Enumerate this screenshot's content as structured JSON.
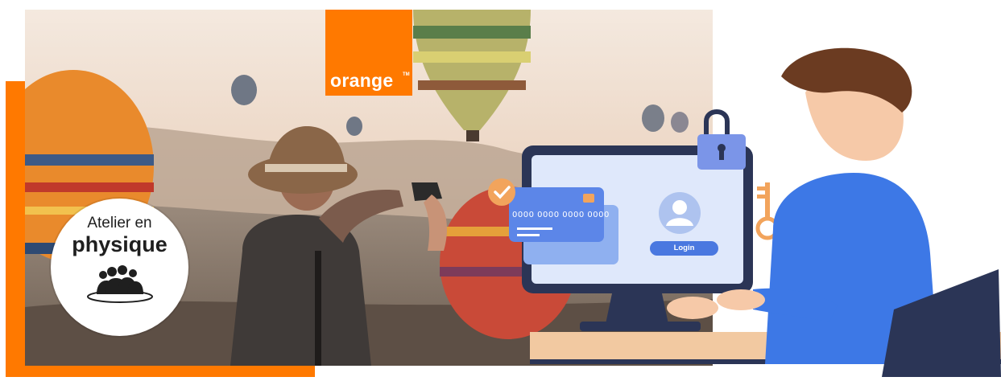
{
  "brand": {
    "logo_text": "orange",
    "trademark": "TM",
    "color": "#ff7900"
  },
  "badge": {
    "line1": "Atelier en",
    "line2": "physique",
    "icon": "group-people-icon"
  },
  "illustration": {
    "card_number": "0000 0000 0000 0000",
    "login_label": "Login",
    "icons": [
      "padlock-icon",
      "key-icon",
      "user-avatar-icon",
      "check-circle-icon"
    ]
  },
  "colors": {
    "accent": "#ff7900",
    "screen_blue": "#dfe8fb",
    "shirt_blue": "#3d78e6",
    "navy": "#2b3556"
  }
}
